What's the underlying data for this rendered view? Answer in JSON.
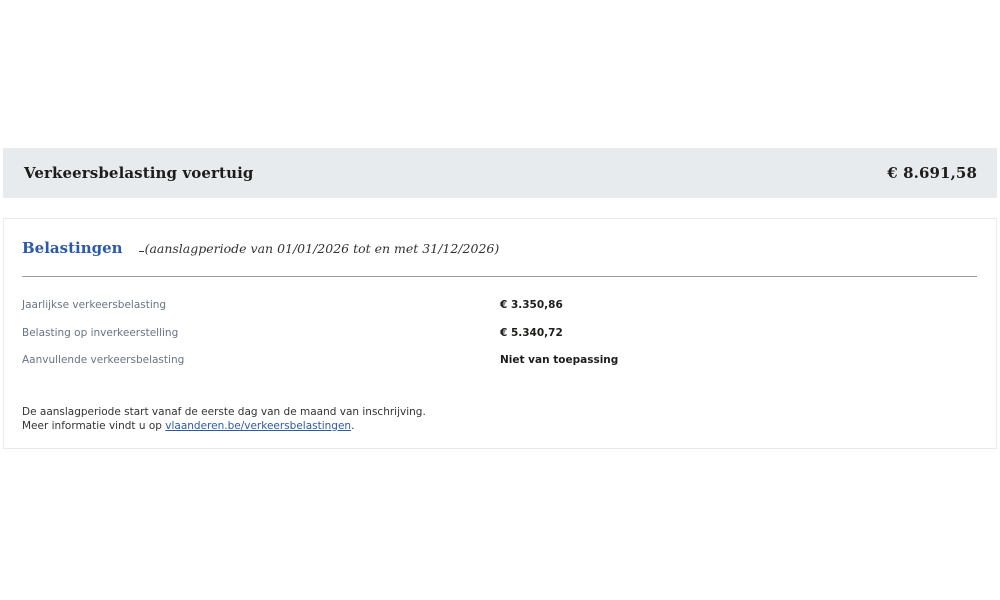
{
  "summary": {
    "title": "Verkeersbelasting voertuig",
    "amount": "€ 8.691,58"
  },
  "panel": {
    "title": "Belastingen",
    "period": "(aanslagperiode van 01/01/2026 tot en met 31/12/2026)",
    "rows": [
      {
        "label": "Jaarlijkse verkeersbelasting",
        "value": "€ 3.350,86"
      },
      {
        "label": "Belasting op inverkeerstelling",
        "value": "€ 5.340,72"
      },
      {
        "label": "Aanvullende verkeersbelasting",
        "value": "Niet van toepassing"
      }
    ],
    "note_line1": "De aanslagperiode start vanaf de eerste dag van de maand van inschrijving.",
    "note_line2_prefix": "Meer informatie vindt u op ",
    "note_link": "vlaanderen.be/verkeersbelastingen",
    "note_line2_suffix": "."
  },
  "colors": {
    "accent": "#2d5aa8",
    "summary_background": "#e8ebee",
    "label_text": "#687483"
  }
}
